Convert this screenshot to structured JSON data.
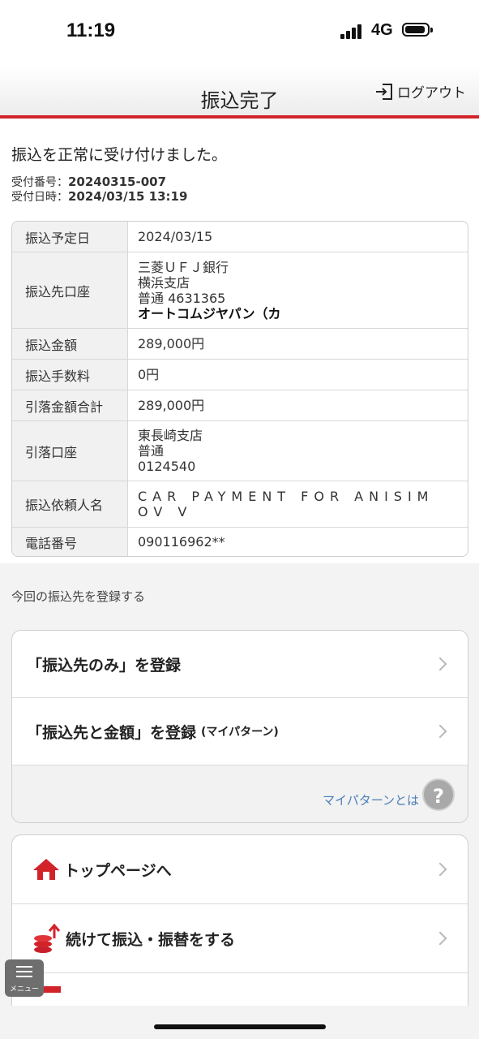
{
  "status": {
    "time": "11:19",
    "network": "4G"
  },
  "header": {
    "title": "振込完了",
    "logout": "ログアウト"
  },
  "confirm": {
    "message": "振込を正常に受け付けました。",
    "receipt_no_label": "受付番号：",
    "receipt_no": "20240315-007",
    "receipt_date_label": "受付日時：",
    "receipt_date": "2024/03/15 13:19"
  },
  "details": {
    "scheduled_date": {
      "label": "振込予定日",
      "value": "2024/03/15"
    },
    "payee_account": {
      "label": "振込先口座",
      "bank": "三菱ＵＦＪ銀行",
      "branch": "横浜支店",
      "account": "普通 4631365",
      "name": "オートコムジヤパン（カ"
    },
    "amount": {
      "label": "振込金額",
      "value": "289,000円"
    },
    "fee": {
      "label": "振込手数料",
      "value": "0円"
    },
    "total": {
      "label": "引落金額合計",
      "value": "289,000円"
    },
    "debit_account": {
      "label": "引落口座",
      "branch": "東長崎支店",
      "type": "普通",
      "number": "0124540"
    },
    "requester": {
      "label": "振込依頼人名",
      "line1": "CAR PAYMENT FOR ANISIM",
      "line2": "OV V"
    },
    "phone": {
      "label": "電話番号",
      "value": "090116962**"
    }
  },
  "register": {
    "section_label": "今回の振込先を登録する",
    "payee_only": "「振込先のみ」を登録",
    "payee_amount": "「振込先と金額」を登録",
    "payee_amount_note": "(マイパターン)",
    "mypattern_link": "マイパターンとは",
    "help": "?"
  },
  "nav": {
    "top_page": "トップページへ",
    "continue": "続けて振込・振替をする"
  },
  "menu": {
    "label": "メニュー"
  },
  "colors": {
    "accent": "#d2232a",
    "link": "#4a7fb8"
  }
}
